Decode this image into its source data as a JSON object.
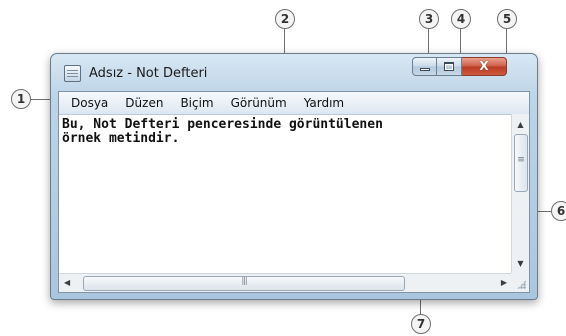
{
  "window": {
    "title": "Adsız - Not Defteri",
    "close_glyph": "X"
  },
  "menu": {
    "items": [
      {
        "label": "Dosya"
      },
      {
        "label": "Düzen"
      },
      {
        "label": "Biçim"
      },
      {
        "label": "Görünüm"
      },
      {
        "label": "Yardım"
      }
    ]
  },
  "editor": {
    "text": "Bu, Not Defteri penceresinde görüntülenen\nörnek metindir."
  },
  "callouts": [
    "1",
    "2",
    "3",
    "4",
    "5",
    "6",
    "7"
  ],
  "icons": {
    "app": "notepad-icon",
    "minimize": "minimize-icon",
    "maximize": "maximize-icon",
    "close": "close-icon"
  },
  "colors": {
    "titlebar": "#bcd4e8",
    "close_button": "#c74a32",
    "background": "#ffffff"
  }
}
